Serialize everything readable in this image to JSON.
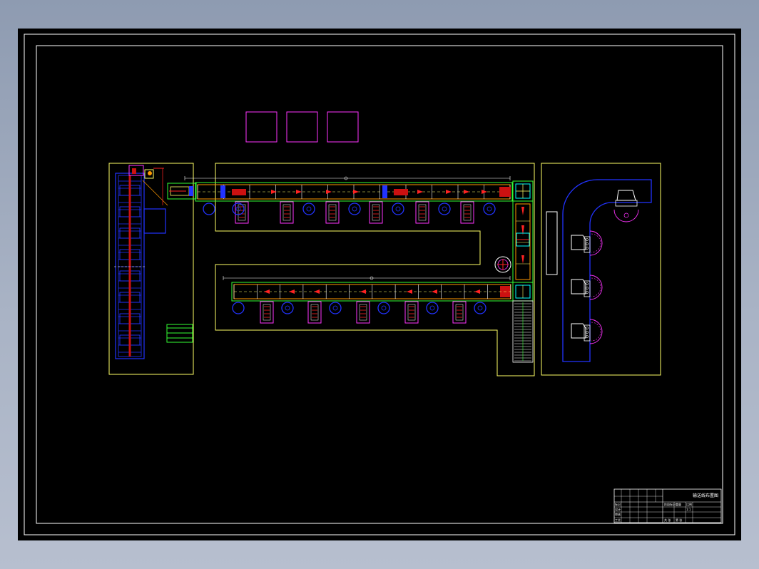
{
  "drawing": {
    "title_block": {
      "drawing_name": "输送线布置图",
      "row_labels": [
        "标记",
        "设计",
        "审核",
        "工艺"
      ],
      "field_labels": [
        "阶段标记",
        "重量",
        "比例",
        "共 张",
        "第 张"
      ],
      "scale": "1:1"
    }
  },
  "colors": {
    "background": "#000000",
    "frame": "#ffffff",
    "boundary": "#ffff66",
    "conveyor": "#33ff33",
    "equipment": "#ff33ff",
    "stations": "#2233ff",
    "arrows": "#ff2222",
    "structure": "#ff9900",
    "cyan": "#00ffff"
  }
}
